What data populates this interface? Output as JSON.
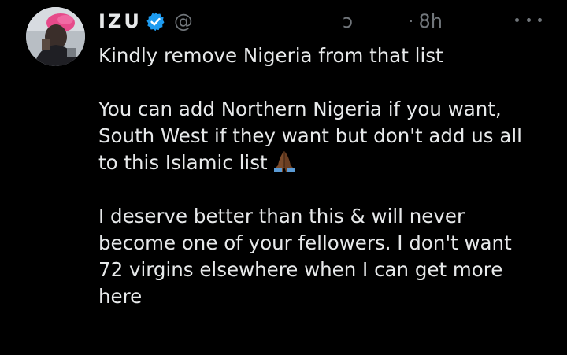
{
  "author": {
    "display_name": "IZU",
    "handle_start": "@",
    "handle_end": "ɔ",
    "separator": "·",
    "time": "8h",
    "verified_icon": "verified-badge-icon",
    "avatar_icon": "profile-avatar"
  },
  "tweet": {
    "line1": "Kindly remove Nigeria from that list",
    "line2": "You can add Northern Nigeria if you want,",
    "line3": "South West if they want but don't add us all",
    "line4": "to this Islamic list",
    "line4_emoji": "folded-hands-emoji",
    "line5": "I deserve better than this & will never",
    "line6": "become one of your fellowers. I don't want",
    "line7": "72 virgins elsewhere when I can get more",
    "line8": "here"
  },
  "menu": {
    "more_icon": "more-options-icon"
  },
  "colors": {
    "background": "#000000",
    "text": "#e7e9ea",
    "secondary": "#71767b",
    "verified_blue": "#1d9bf0"
  }
}
